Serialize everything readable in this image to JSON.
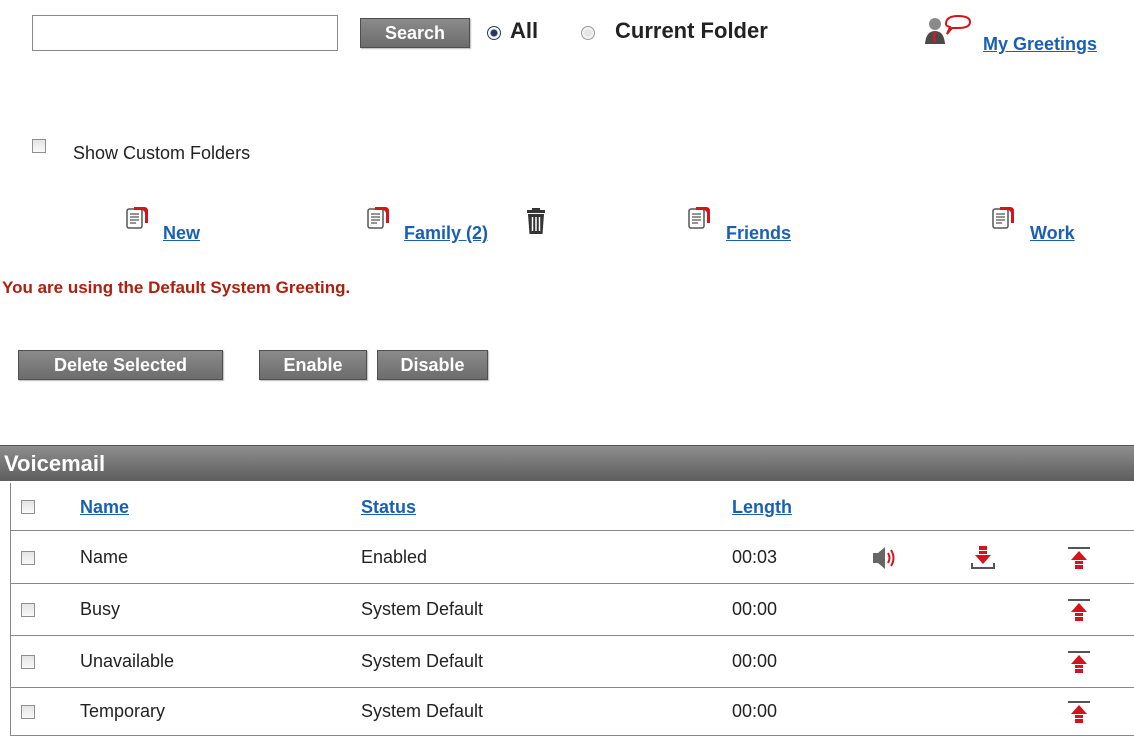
{
  "search": {
    "value": "",
    "placeholder": "",
    "button_label": "Search"
  },
  "scope": {
    "options": [
      "All",
      "Current Folder"
    ],
    "selected": "All"
  },
  "my_greetings_label": "My Greetings",
  "show_custom_folders_label": "Show Custom Folders",
  "folders": [
    {
      "label": "New"
    },
    {
      "label": "Family (2)"
    },
    {
      "label": "Friends"
    },
    {
      "label": "Work"
    }
  ],
  "notice": "You are using the Default System Greeting.",
  "actions": {
    "delete_label": "Delete Selected",
    "enable_label": "Enable",
    "disable_label": "Disable"
  },
  "table": {
    "title": "Voicemail",
    "columns": [
      "Name",
      "Status",
      "Length"
    ],
    "rows": [
      {
        "name": "Name",
        "status": "Enabled",
        "length": "00:03",
        "has_play": true,
        "has_download": true,
        "has_upload": true
      },
      {
        "name": "Busy",
        "status": "System Default",
        "length": "00:00",
        "has_play": false,
        "has_download": false,
        "has_upload": true
      },
      {
        "name": "Unavailable",
        "status": "System Default",
        "length": "00:00",
        "has_play": false,
        "has_download": false,
        "has_upload": true
      },
      {
        "name": "Temporary",
        "status": "System Default",
        "length": "00:00",
        "has_play": false,
        "has_download": false,
        "has_upload": true
      }
    ]
  },
  "colors": {
    "link": "#1a5fb4",
    "notice": "#b01e0e",
    "accent_red": "#d4141a",
    "button_gray": "#7a7a7a"
  }
}
